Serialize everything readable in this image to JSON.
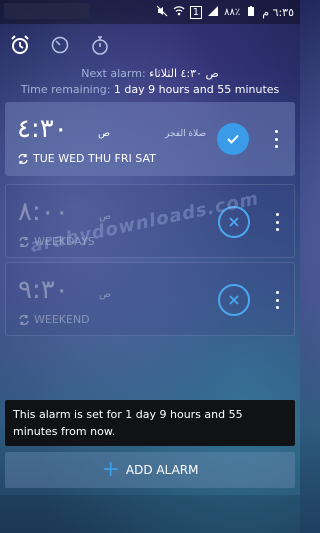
{
  "status_bar": {
    "time": "٦:٣٥ م",
    "battery": "٨٨٪"
  },
  "toolbar": {
    "tabs": [
      {
        "icon": "alarm-clock-icon"
      },
      {
        "icon": "timer-icon"
      },
      {
        "icon": "stopwatch-icon"
      }
    ]
  },
  "next_alarm": {
    "label": "Next alarm:",
    "value": "ص ٤:٣٠ الثلاثاء",
    "remaining_label": "Time remaining:",
    "remaining_value": "1 day 9 hours and 55 minutes"
  },
  "alarms": [
    {
      "time": "٤:٣٠",
      "ampm": "ص",
      "label": "صلاة الفجر",
      "days": "TUE WED THU FRI SAT",
      "enabled": true
    },
    {
      "time": "٨:٠٠",
      "ampm": "ص",
      "label": "",
      "days": "WEEKDAYS",
      "enabled": false
    },
    {
      "time": "٩:٣٠",
      "ampm": "ص",
      "label": "",
      "days": "WEEKEND",
      "enabled": false
    }
  ],
  "watermark": "arabydownloads.com",
  "toast": "This alarm is set for 1 day 9 hours and 55 minutes from now.",
  "add_button": {
    "label": "ADD ALARM"
  },
  "colors": {
    "accent": "#3a9be8",
    "toast_bg": "#101215"
  }
}
